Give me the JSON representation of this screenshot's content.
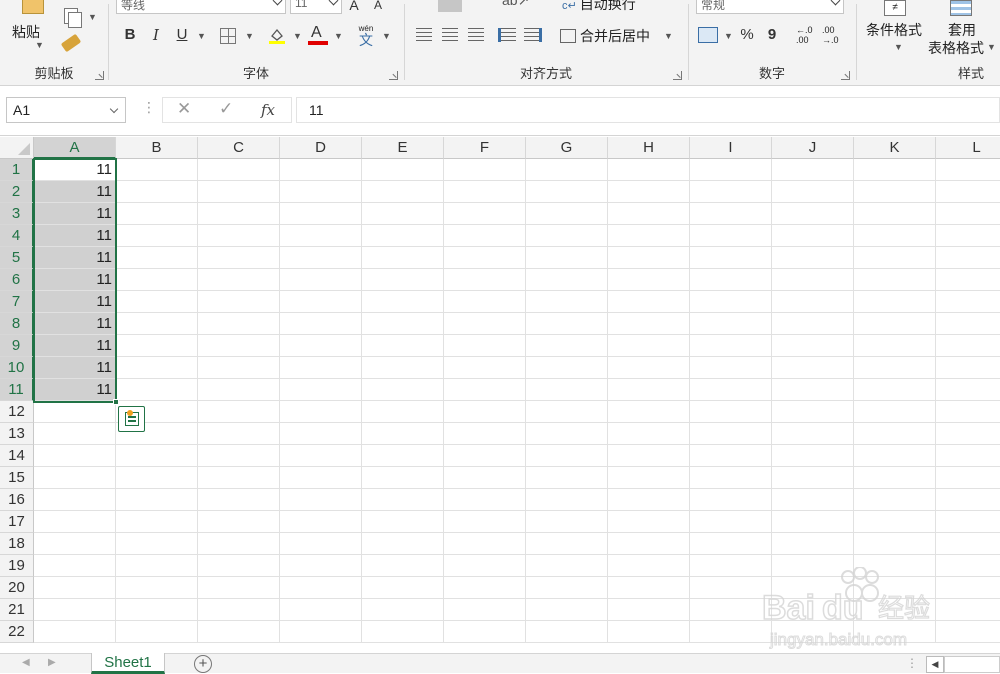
{
  "ribbon": {
    "clipboard": {
      "paste_label": "粘贴",
      "group_label": "剪贴板"
    },
    "font": {
      "font_name": "等线",
      "font_size": "11",
      "bold": "B",
      "italic": "I",
      "underline": "U",
      "phonetic": "文",
      "phonetic_top": "wén",
      "group_label": "字体"
    },
    "alignment": {
      "wrap_text": "自动换行",
      "merge_center": "合并后居中",
      "group_label": "对齐方式"
    },
    "number": {
      "format": "常规",
      "percent": "%",
      "comma": "9",
      "inc_decimal": "←.0\n.00",
      "dec_decimal": ".00\n→.0",
      "group_label": "数字"
    },
    "styles": {
      "conditional_format": "条件格式",
      "format_as_table_line1": "套用",
      "format_as_table_line2": "表格格式",
      "group_label": "样式"
    }
  },
  "formula_bar": {
    "name_box": "A1",
    "value": "11",
    "fx": "fx"
  },
  "columns": [
    "A",
    "B",
    "C",
    "D",
    "E",
    "F",
    "G",
    "H",
    "I",
    "J",
    "K",
    "L"
  ],
  "rows": [
    "1",
    "2",
    "3",
    "4",
    "5",
    "6",
    "7",
    "8",
    "9",
    "10",
    "11",
    "12",
    "13",
    "14",
    "15",
    "16",
    "17",
    "18",
    "19",
    "20",
    "21",
    "22"
  ],
  "cells_A": [
    "11",
    "11",
    "11",
    "11",
    "11",
    "11",
    "11",
    "11",
    "11",
    "11",
    "11"
  ],
  "sheet_tab": "Sheet1",
  "colors": {
    "excel_green": "#217346",
    "selection_fill": "#d0d0d0"
  }
}
